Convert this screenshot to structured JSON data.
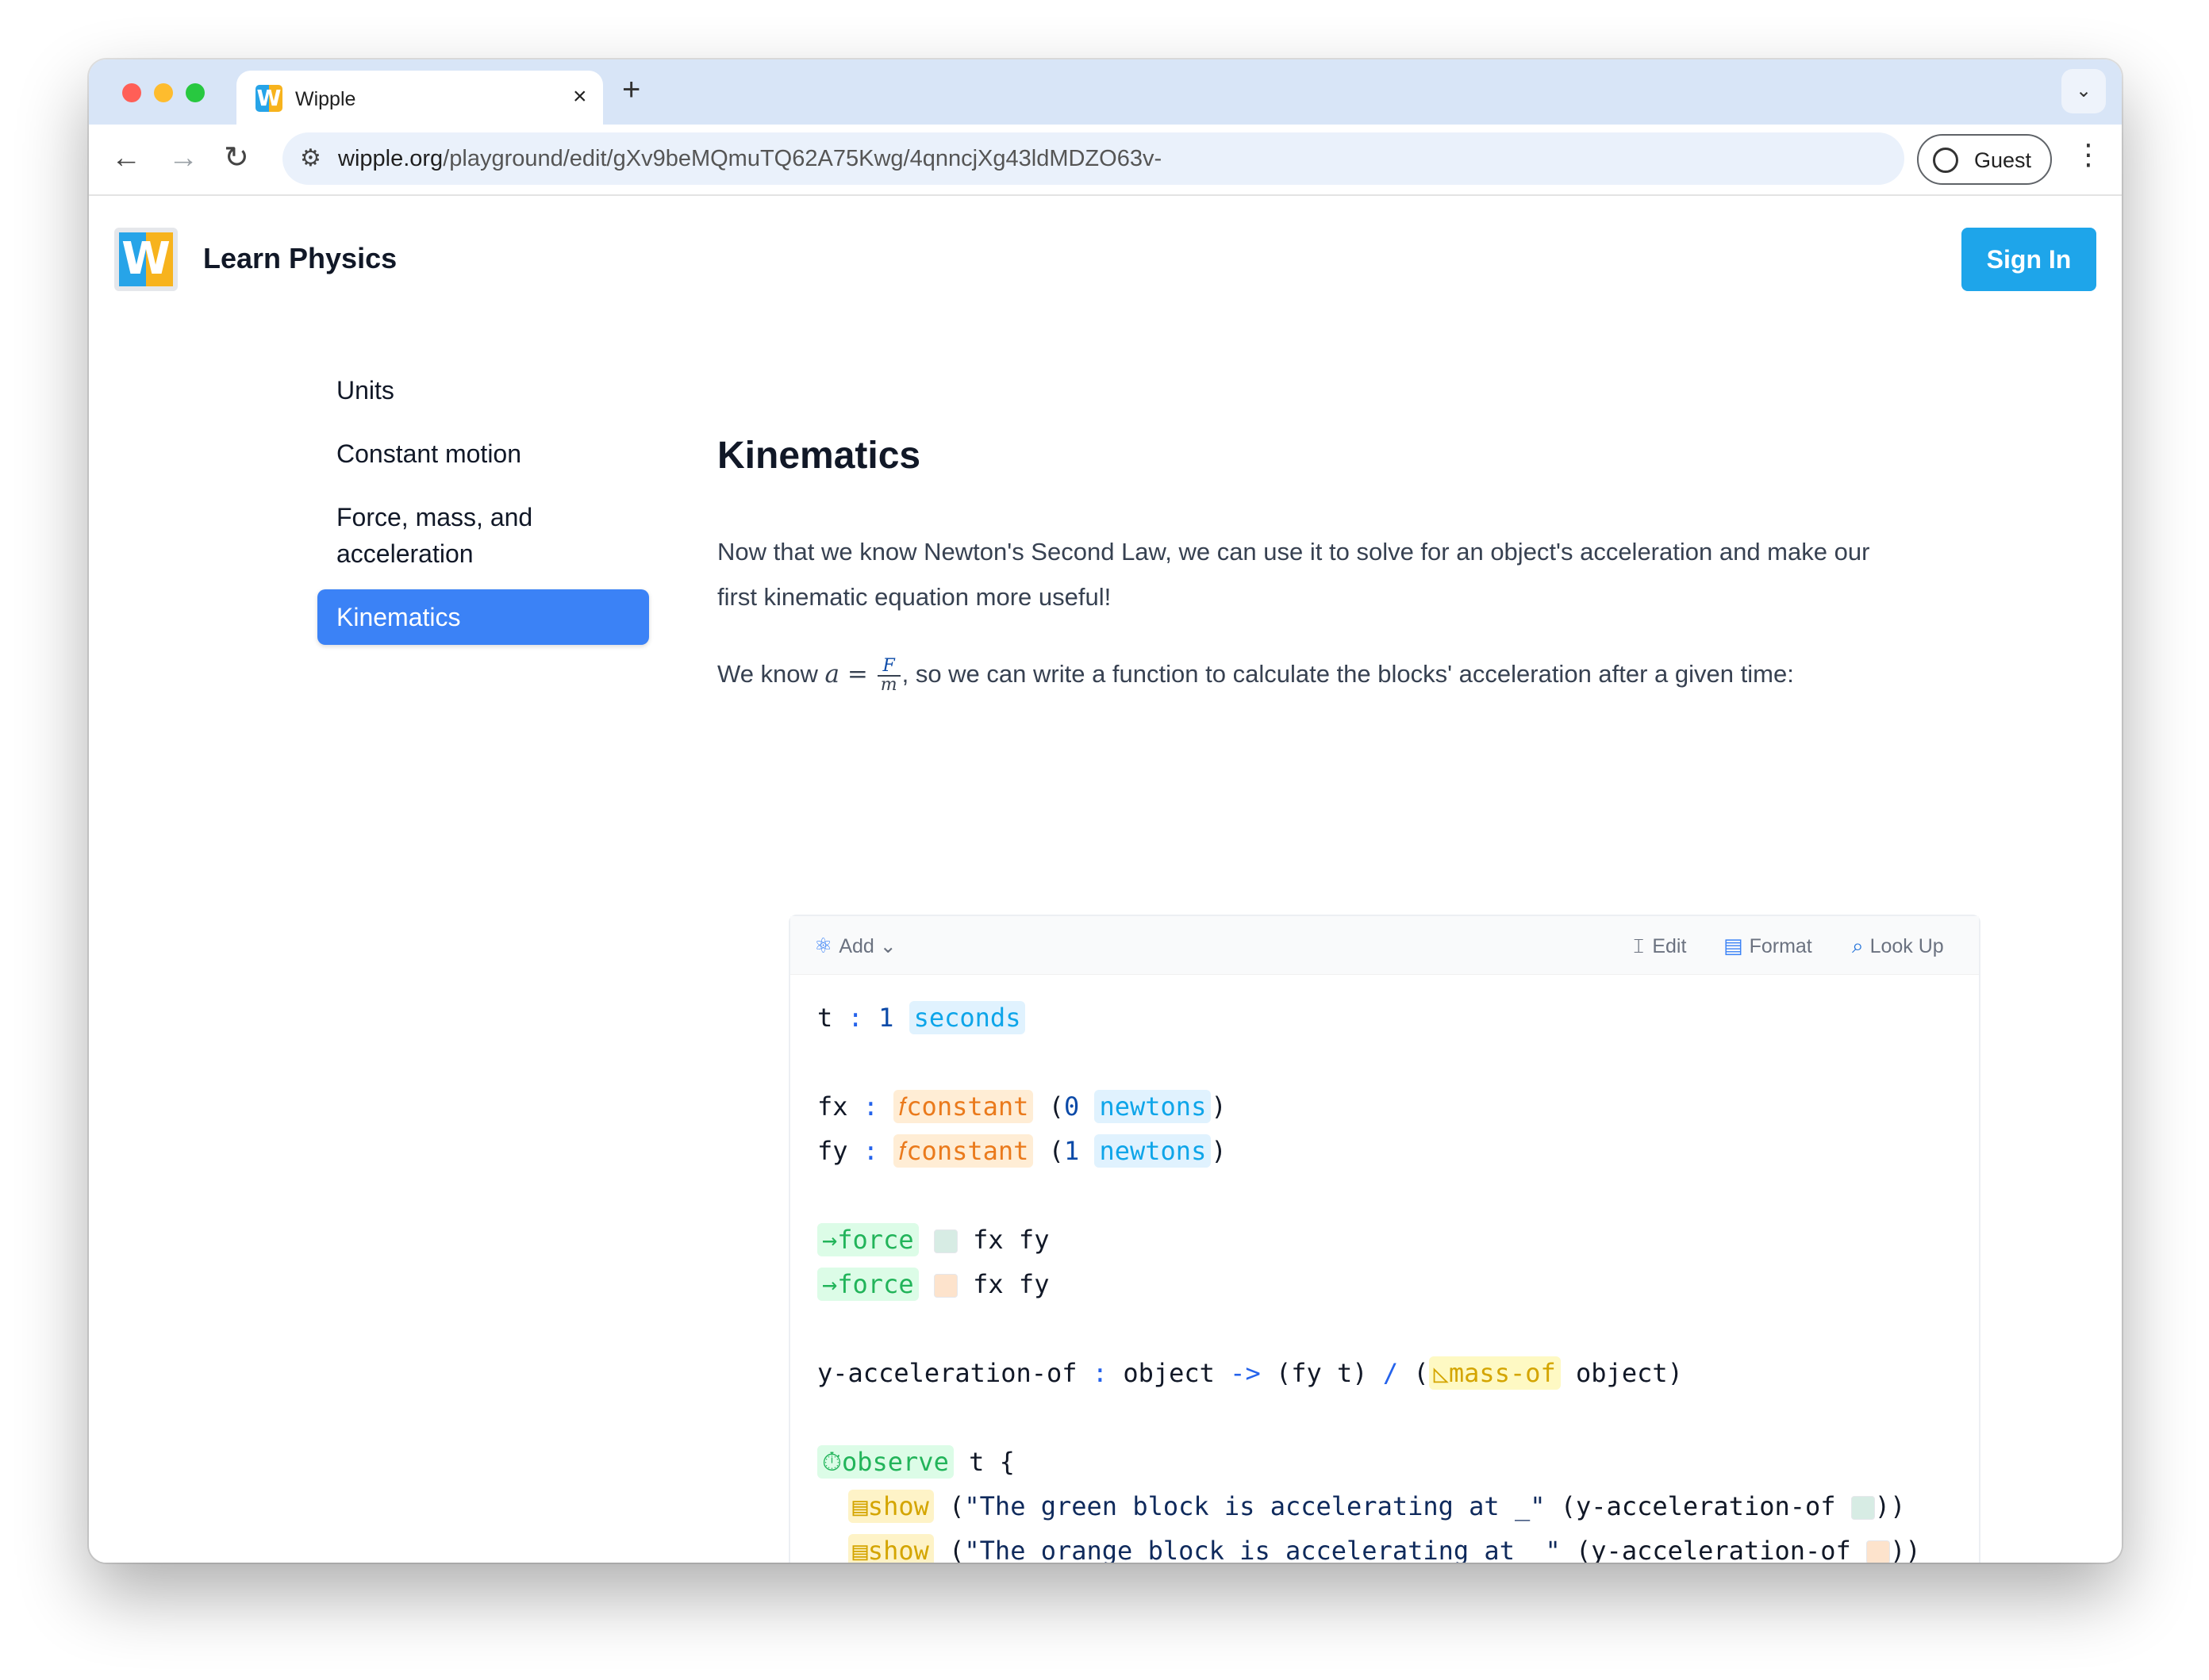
{
  "browser": {
    "tab_title": "Wipple",
    "tab_favicon_letter": "W",
    "tab_close": "×",
    "new_tab": "+",
    "url_host": "wipple.org",
    "url_path": "/playground/edit/gXv9beMQmuTQ62A75Kwg/4qnncjXg43ldMDZO63v-",
    "profile_label": "Guest",
    "icons": [
      "back-arrow-icon",
      "forward-arrow-icon",
      "reload-icon",
      "site-settings-icon",
      "profile-icon",
      "more-vert-icon",
      "tab-list-chevron-icon"
    ]
  },
  "header": {
    "logo_letter": "W",
    "title": "Learn Physics",
    "signin_label": "Sign In",
    "colors": {
      "brand_blue": "#1ea5ea",
      "brand_yellow": "#f7b31d"
    }
  },
  "sidebar": {
    "items": [
      {
        "label": "Units",
        "active": false
      },
      {
        "label": "Constant motion",
        "active": false
      },
      {
        "label": "Force, mass, and acceleration",
        "active": false
      },
      {
        "label": "Kinematics",
        "active": true
      }
    ],
    "active_color": "#3b82f6"
  },
  "main": {
    "heading": "Kinematics",
    "paragraph1": "Now that we know Newton's Second Law, we can use it to solve for an object's acceleration and make our first kinematic equation more useful!",
    "p2_before": "We know ",
    "p2_math_a": "a",
    "p2_math_eq": " = ",
    "p2_frac_num": "F",
    "p2_frac_den": "m",
    "p2_after": ", so we can write a function to calculate the blocks' acceleration after a given time:"
  },
  "editor": {
    "toolbar": {
      "add_label": "Add",
      "edit_label": "Edit",
      "format_label": "Format",
      "lookup_label": "Look Up"
    },
    "code": {
      "t_name": "t",
      "t_value": "1",
      "t_unit": "seconds",
      "fx_name": "fx",
      "fy_name": "fy",
      "constant_kw": "constant",
      "fx_value": "0",
      "fy_value": "1",
      "newtons": "newtons",
      "force_kw": "force",
      "fx_fy": "fx fy",
      "fn_name": "y-acceleration-of",
      "fn_param": "object",
      "arrow": "->",
      "fy_t": "(fy t)",
      "div": "/",
      "mass_kw": "mass-of",
      "object_close": "object)",
      "observe_kw": "observe",
      "observe_rest": "t {",
      "show_kw": "show",
      "str_green": "\"The green block is accelerating at _\"",
      "str_orange": "\"The orange block is accelerating at _\"",
      "call_fn": "(y-acceleration-of",
      "close_brace": "}"
    },
    "colors": {
      "green_block": "#d7ece4",
      "orange_block": "#fde3cc"
    }
  }
}
